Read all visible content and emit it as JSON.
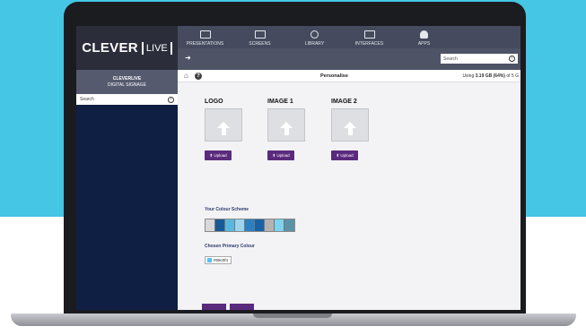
{
  "brand": {
    "name": "CLEVER",
    "live": "LIVE"
  },
  "org": {
    "name": "CLEVERLIVE",
    "subtitle": "DIGITAL SIGNAGE"
  },
  "sidebar": {
    "search_placeholder": "Search"
  },
  "nav": {
    "items": [
      {
        "label": "PRESENTATIONS",
        "icon": "presentation-icon"
      },
      {
        "label": "SCREENS",
        "icon": "monitor-icon"
      },
      {
        "label": "LIBRARY",
        "icon": "library-icon"
      },
      {
        "label": "INTERFACES",
        "icon": "interfaces-icon"
      },
      {
        "label": "APPS",
        "icon": "android-icon"
      }
    ],
    "search_placeholder": "Search"
  },
  "crumb": {
    "title": "Personalise",
    "usage_prefix": "Using ",
    "usage_value": "3.19 GB (64%)",
    "usage_suffix": " of 5 G"
  },
  "images": [
    {
      "title": "LOGO",
      "upload_label": "Upload"
    },
    {
      "title": "IMAGE 1",
      "upload_label": "Upload"
    },
    {
      "title": "IMAGE 2",
      "upload_label": "Upload"
    }
  ],
  "colour_scheme": {
    "label": "Your Colour Scheme",
    "swatches": [
      "#d9d9d9",
      "#1a5a94",
      "#5ab8df",
      "#9bd4ec",
      "#2c7fc0",
      "#1863a6",
      "#b3b3b3",
      "#7dd3f0",
      "#5b92a8"
    ]
  },
  "primary": {
    "label": "Chosen Primary Colour",
    "value": "#59c0f4",
    "color": "#59c0f4"
  },
  "colors": {
    "accent": "#5a2a7d",
    "sidebar": "#0f1f44",
    "nav": "#454a5e",
    "background": "#45c6e4"
  }
}
